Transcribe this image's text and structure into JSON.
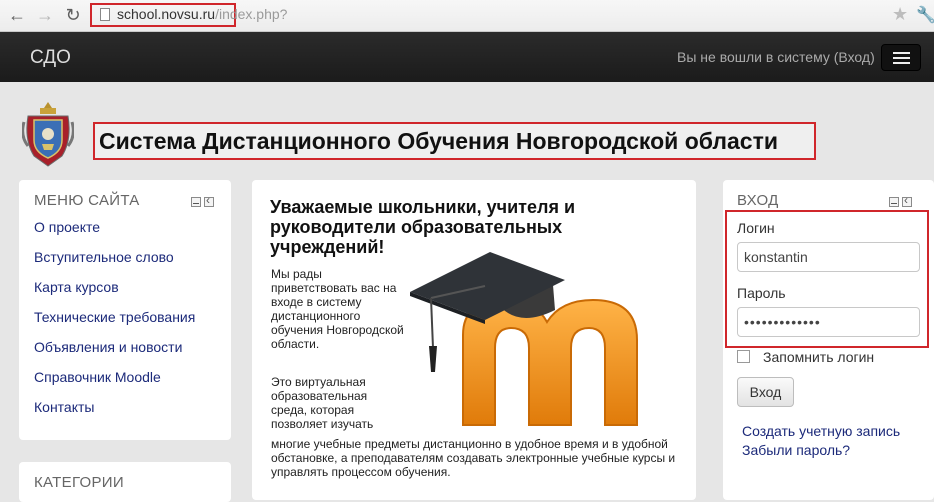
{
  "browser": {
    "url_domain": "school.novsu.ru",
    "url_path": "/index.php?"
  },
  "navbar": {
    "brand": "СДО",
    "login_status": "Вы не вошли в систему (Вход)"
  },
  "header": {
    "site_title": "Система Дистанционного Обучения Новгородской области"
  },
  "site_menu": {
    "title": "МЕНЮ САЙТА",
    "items": [
      "О проекте",
      "Вступительное слово",
      "Карта курсов",
      "Технические требования",
      "Объявления и новости",
      "Справочник Moodle",
      "Контакты"
    ]
  },
  "categories": {
    "title": "КАТЕГОРИИ"
  },
  "main": {
    "welcome_title": "Уважаемые школьники, учителя и руководители образовательных учреждений!",
    "para1": "Мы рады приветствовать вас на входе в систему дистанционного обучения Новгородской области.",
    "para2_short": "Это виртуальная образовательная среда, которая позволяет изучать",
    "para2_wide": "многие учебные предметы дистанционно в удобное время и в удобной обстановке, а преподавателям создавать электронные учебные курсы и управлять процессом обучения."
  },
  "login": {
    "title": "ВХОД",
    "username_label": "Логин",
    "username_value": "konstantin",
    "password_label": "Пароль",
    "password_value": "•••••••••••••",
    "remember_label": "Запомнить логин",
    "submit_label": "Вход",
    "create_account": "Создать учетную запись",
    "forgot_password": "Забыли пароль?"
  },
  "colors": {
    "highlight_border": "#d0262b",
    "link": "#1c2a7a",
    "moodle_orange": "#f7931e"
  }
}
